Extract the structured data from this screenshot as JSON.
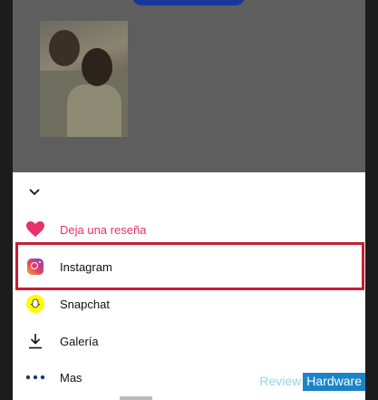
{
  "share_sheet": {
    "items": [
      {
        "label": "Deja una reseña",
        "icon": "heart-icon"
      },
      {
        "label": "Instagram",
        "icon": "instagram-icon"
      },
      {
        "label": "Snapchat",
        "icon": "snapchat-icon"
      },
      {
        "label": "Galería",
        "icon": "download-icon"
      },
      {
        "label": "Mas",
        "icon": "more-icon"
      }
    ],
    "collapse_icon": "chevron-down-icon"
  },
  "watermark": {
    "part1": "Review",
    "part2": "Hardware"
  },
  "colors": {
    "review_pink": "#e8306a",
    "highlight_red": "#c61d33",
    "snapchat_yellow": "#fffc00",
    "top_button_blue": "#17389a"
  }
}
